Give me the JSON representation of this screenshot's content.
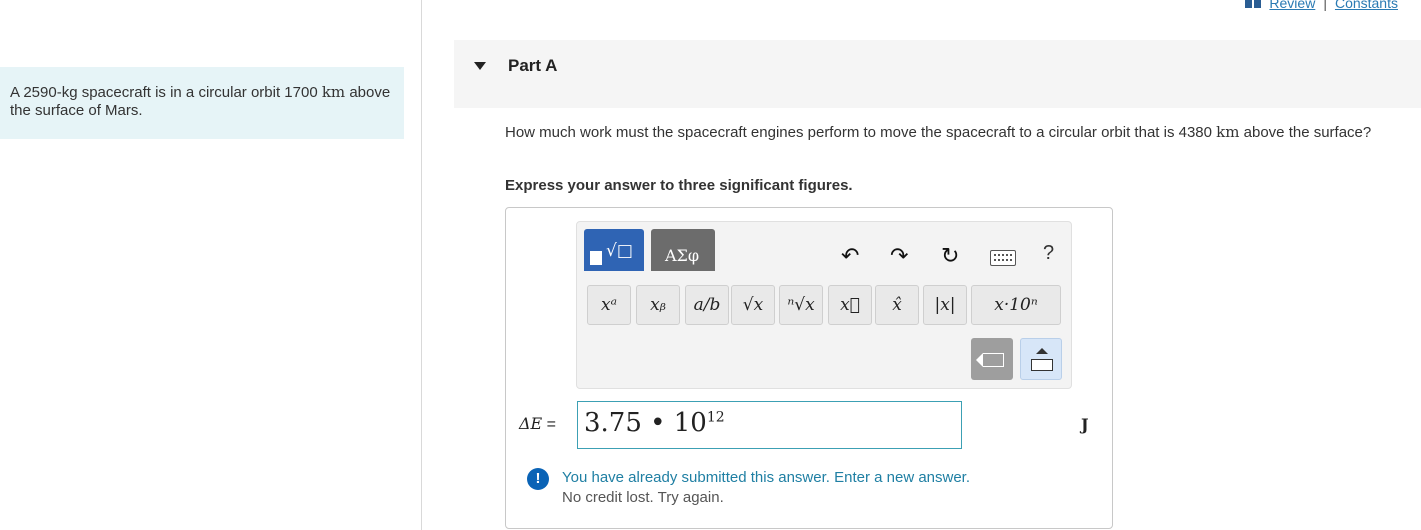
{
  "top_links": {
    "review": "Review",
    "separator": "|",
    "constants": "Constants"
  },
  "problem": {
    "text": "A 2590-kg spacecraft is in a circular orbit 1700 ",
    "unit": "km",
    "text2": " above the surface of Mars."
  },
  "part": {
    "title": "Part A"
  },
  "question": {
    "text": "How much work must the spacecraft engines perform to move the spacecraft to a circular orbit that is 4380 ",
    "unit": "km",
    "text2": " above the surface?"
  },
  "instruction": "Express your answer to three significant figures.",
  "toolbar": {
    "tab_math_label": "√□",
    "tab_greek_label": "ΑΣφ",
    "undo": "↶",
    "redo": "↷",
    "reset": "↻",
    "help": "?",
    "keys": [
      "xᵃ",
      "xᵦ",
      "a/b",
      "√x",
      "ⁿ√x",
      "x⃗",
      "x̂",
      "|x|",
      "x·10ⁿ"
    ]
  },
  "answer": {
    "variable": "ΔE",
    "equals": " =",
    "value_mantissa": "3.75 • 10",
    "value_exponent": "12",
    "unit": "J"
  },
  "feedback": {
    "icon": "!",
    "message": "You have already submitted this answer. Enter a new answer.",
    "submessage": "No credit lost. Try again."
  }
}
